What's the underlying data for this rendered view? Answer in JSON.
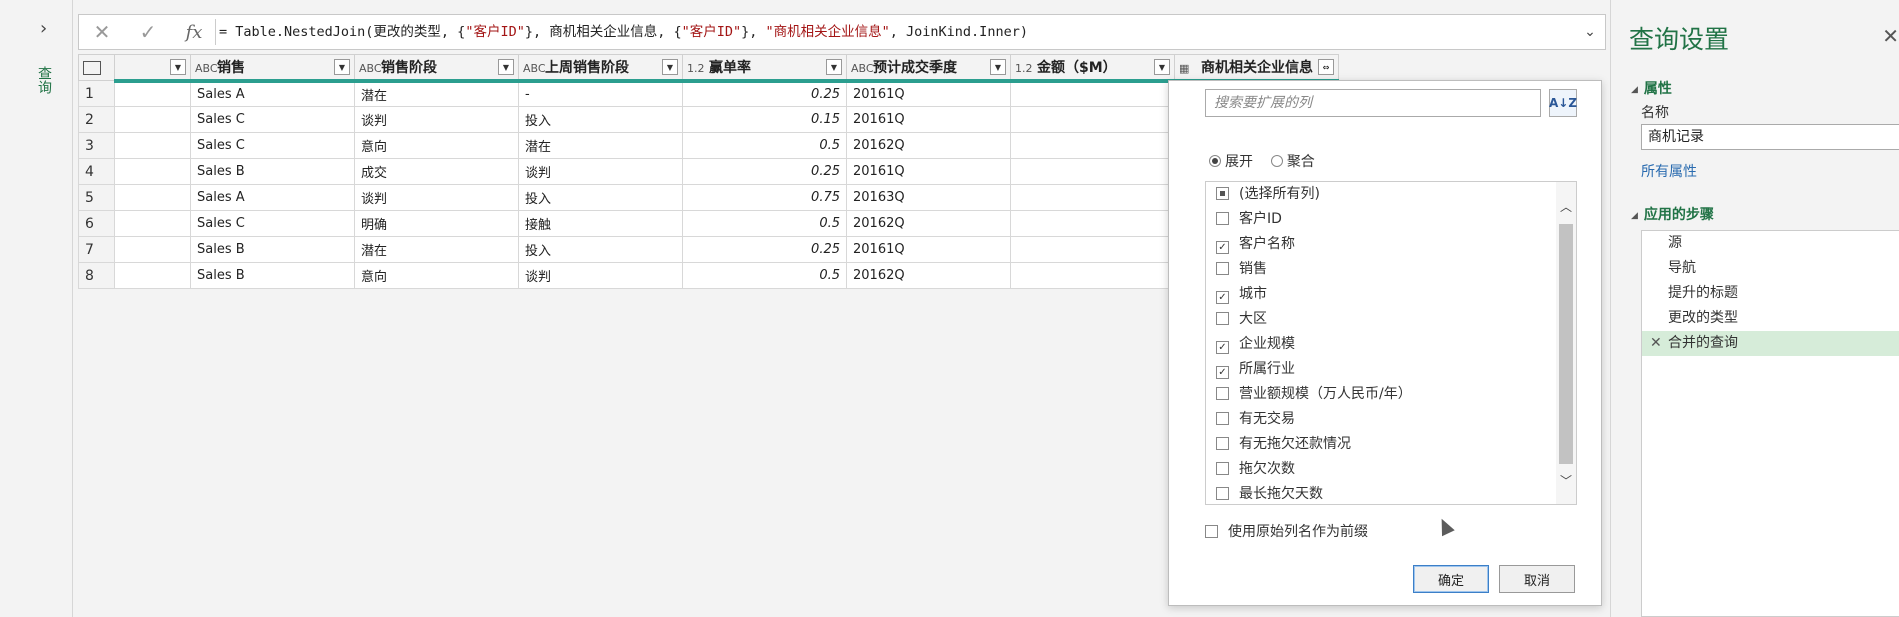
{
  "left_pane": {
    "expand_icon": "chevron-right-icon",
    "label": "查询"
  },
  "formula_bar": {
    "cancel_icon": "close-icon",
    "commit_icon": "check-icon",
    "fx_label": "fx",
    "formula_parts": [
      {
        "t": "= Table.NestedJoin(更改的类型, {",
        "s": false
      },
      {
        "t": "\"客户ID\"",
        "s": true
      },
      {
        "t": "}, 商机相关企业信息, {",
        "s": false
      },
      {
        "t": "\"客户ID\"",
        "s": true
      },
      {
        "t": "}, ",
        "s": false
      },
      {
        "t": "\"商机相关企业信息\"",
        "s": true
      },
      {
        "t": ", JoinKind.Inner)",
        "s": false
      }
    ],
    "expand_icon": "chevron-down-icon"
  },
  "grid": {
    "columns": [
      {
        "type": "",
        "name": ""
      },
      {
        "type": "ABC",
        "name": "销售"
      },
      {
        "type": "ABC",
        "name": "销售阶段"
      },
      {
        "type": "ABC",
        "name": "上周销售阶段"
      },
      {
        "type": "1.2",
        "name": "赢单率"
      },
      {
        "type": "ABC",
        "name": "预计成交季度"
      },
      {
        "type": "1.2",
        "name": "金额（$M）"
      },
      {
        "type": "table",
        "name": "商机相关企业信息"
      }
    ],
    "rows": [
      [
        "1",
        "",
        "Sales A",
        "潜在",
        "-",
        "0.25",
        "20161Q"
      ],
      [
        "2",
        "",
        "Sales C",
        "谈判",
        "投入",
        "0.15",
        "20161Q"
      ],
      [
        "3",
        "",
        "Sales C",
        "意向",
        "潜在",
        "0.5",
        "20162Q"
      ],
      [
        "4",
        "",
        "Sales B",
        "成交",
        "谈判",
        "0.25",
        "20161Q"
      ],
      [
        "5",
        "",
        "Sales A",
        "谈判",
        "投入",
        "0.75",
        "20163Q"
      ],
      [
        "6",
        "",
        "Sales C",
        "明确",
        "接触",
        "0.5",
        "20162Q"
      ],
      [
        "7",
        "",
        "Sales B",
        "潜在",
        "投入",
        "0.25",
        "20161Q"
      ],
      [
        "8",
        "",
        "Sales B",
        "意向",
        "谈判",
        "0.5",
        "20162Q"
      ]
    ]
  },
  "expand_popup": {
    "search_placeholder": "搜索要扩展的列",
    "sort_icon": "sort-az-icon",
    "mode_expand": "展开",
    "mode_aggregate": "聚合",
    "columns": [
      {
        "label": "(选择所有列)",
        "state": "partial"
      },
      {
        "label": "客户ID",
        "state": "off"
      },
      {
        "label": "客户名称",
        "state": "on"
      },
      {
        "label": "销售",
        "state": "off"
      },
      {
        "label": "城市",
        "state": "on"
      },
      {
        "label": "大区",
        "state": "off"
      },
      {
        "label": "企业规模",
        "state": "on"
      },
      {
        "label": "所属行业",
        "state": "on"
      },
      {
        "label": "营业额规模（万人民币/年）",
        "state": "off"
      },
      {
        "label": "有无交易",
        "state": "off"
      },
      {
        "label": "有无拖欠还款情况",
        "state": "off"
      },
      {
        "label": "拖欠次数",
        "state": "off"
      },
      {
        "label": "最长拖欠天数",
        "state": "off"
      }
    ],
    "prefix_label": "使用原始列名作为前缀",
    "ok_label": "确定",
    "cancel_label": "取消"
  },
  "right_pane": {
    "title": "查询设置",
    "properties_section": "属性",
    "name_label": "名称",
    "name_value": "商机记录",
    "all_properties_link": "所有属性",
    "steps_section": "应用的步骤",
    "steps": [
      {
        "label": "源",
        "gear": true,
        "selected": false
      },
      {
        "label": "导航",
        "gear": true,
        "selected": false
      },
      {
        "label": "提升的标题",
        "gear": true,
        "selected": false
      },
      {
        "label": "更改的类型",
        "gear": false,
        "selected": false
      },
      {
        "label": "合并的查询",
        "gear": true,
        "selected": true
      }
    ]
  }
}
